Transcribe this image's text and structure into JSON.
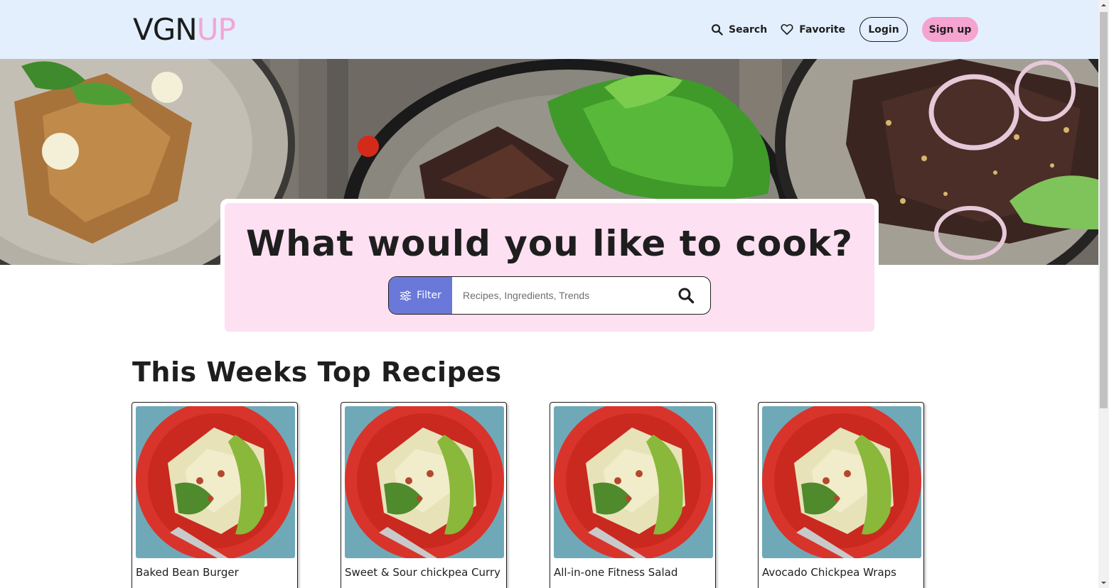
{
  "header": {
    "logo_part1": "VGN",
    "logo_part2": "UP",
    "nav": {
      "search_label": "Search",
      "favorite_label": "Favorite",
      "login_label": "Login",
      "signup_label": "Sign up"
    }
  },
  "hero": {
    "title": "What would you like to cook?",
    "filter_label": "Filter",
    "search_placeholder": "Recipes, Ingredients, Trends"
  },
  "section": {
    "title": "This Weeks Top Recipes"
  },
  "recipes": [
    {
      "name": "Baked Bean Burger"
    },
    {
      "name": "Sweet & Sour chickpea Curry"
    },
    {
      "name": "All-in-one Fitness Salad"
    },
    {
      "name": "Avocado Chickpea Wraps"
    }
  ],
  "colors": {
    "header_bg": "#e3effd",
    "logo_accent": "#f3a6d4",
    "signup_bg": "#f5a3d0",
    "search_card_bg": "#fde0f2",
    "filter_bg": "#6a79d9"
  },
  "icons": {
    "search": "search-icon",
    "favorite": "heart-icon",
    "filter": "sliders-icon"
  }
}
